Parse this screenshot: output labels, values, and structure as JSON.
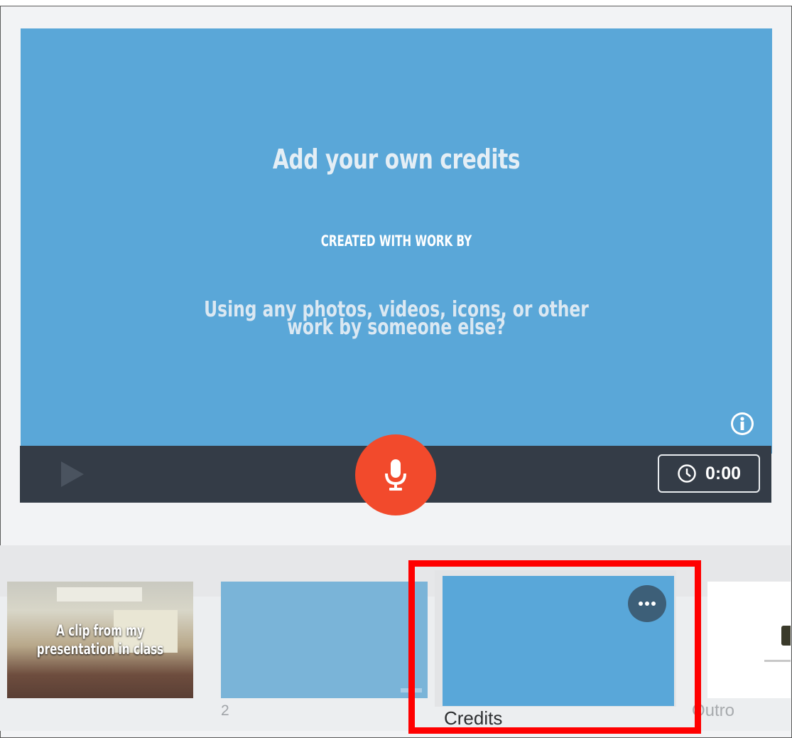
{
  "preview": {
    "title": "Add your own credits",
    "subheading": "CREATED WITH WORK BY",
    "body": "Using any photos, videos, icons, or other work by someone else?"
  },
  "controls": {
    "timer": "0:00"
  },
  "filmstrip": {
    "slides": [
      {
        "caption_line1": "A clip from my",
        "caption_line2": "presentation in class"
      },
      {
        "label": "2"
      },
      {
        "label": "Credits"
      },
      {
        "label": "Outro"
      }
    ]
  },
  "icons": {
    "info": "info-icon",
    "play": "play-icon",
    "mic": "microphone-icon",
    "clock": "clock-icon",
    "more": "more-options-icon"
  },
  "colors": {
    "slide_bg": "#5aa7d8",
    "controlbar": "#343c47",
    "mic_button": "#f24a2c",
    "highlight": "#ff0000"
  }
}
